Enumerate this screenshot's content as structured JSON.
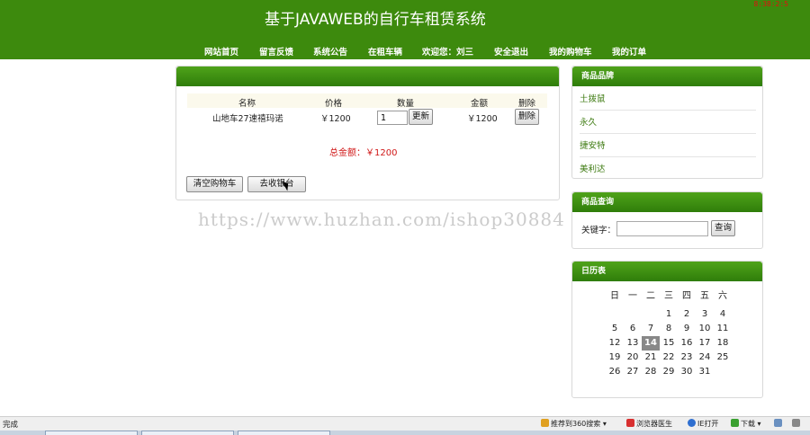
{
  "header": {
    "site_title": "基于JAVAWEB的自行车租赁系统",
    "clock": "8:38:2:5",
    "nav": [
      "网站首页",
      "留言反馈",
      "系统公告",
      "在租车辆",
      "欢迎您：刘三",
      "安全退出",
      "我的购物车",
      "我的订单"
    ]
  },
  "cart": {
    "columns": [
      "名称",
      "价格",
      "数量",
      "金额",
      "删除"
    ],
    "items": [
      {
        "name": "山地车27速禧玛诺",
        "price": "￥1200",
        "qty": "1",
        "update_label": "更新",
        "amount": "￥1200",
        "delete_label": "删除"
      }
    ],
    "total_label": "总金额：￥1200",
    "clear_label": "清空购物车",
    "checkout_label": "去收银台"
  },
  "sidebar": {
    "brands_title": "商品品牌",
    "brands": [
      "土拨鼠",
      "永久",
      "捷安特",
      "美利达"
    ],
    "search_title": "商品查询",
    "search_label": "关键字：",
    "search_button": "查询",
    "calendar_title": "日历表",
    "weekdays": [
      "日",
      "一",
      "二",
      "三",
      "四",
      "五",
      "六"
    ],
    "weeks": [
      [
        "",
        "",
        "",
        "1",
        "2",
        "3",
        "4"
      ],
      [
        "5",
        "6",
        "7",
        "8",
        "9",
        "10",
        "11"
      ],
      [
        "12",
        "13",
        "14",
        "15",
        "16",
        "17",
        "18"
      ],
      [
        "19",
        "20",
        "21",
        "22",
        "23",
        "24",
        "25"
      ],
      [
        "26",
        "27",
        "28",
        "29",
        "30",
        "31",
        ""
      ]
    ],
    "today": "14"
  },
  "watermark": "https://www.huzhan.com/ishop30884",
  "statusbar": {
    "status": "完成",
    "items": [
      "推荐到360搜索",
      "浏览器医生",
      "IE打开",
      "下载"
    ]
  },
  "colors": {
    "header_green": "#3d8a0d",
    "panel_head_green": "#2f7d0a",
    "total_red": "#d01818",
    "brand_link_green": "#3d7a10"
  }
}
